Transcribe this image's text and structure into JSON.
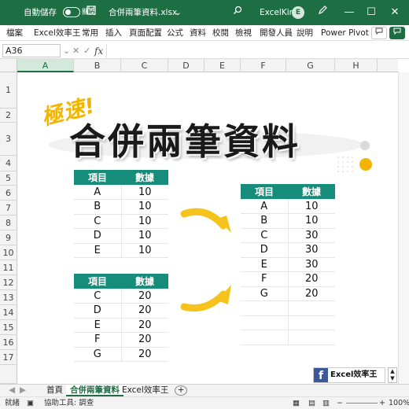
{
  "titlebar": {
    "autosave_label": "自動儲存",
    "autosave_state": "關閉",
    "filename": "合併兩筆資料.xlsx",
    "filename_chevron": "⌄",
    "search_icon": "search-icon",
    "user_name": "ExcelKing",
    "user_initial": "E",
    "pen_icon": "pen-icon",
    "minimize": "—",
    "maximize": "☐",
    "close": "✕",
    "save_icon": "save-icon"
  },
  "ribbon": {
    "tabs": [
      "檔案",
      "Excel效率王",
      "常用",
      "插入",
      "頁面配置",
      "公式",
      "資料",
      "校閱",
      "檢視",
      "開發人員",
      "說明",
      "Power Pivot"
    ],
    "comment_icon": "comment-icon",
    "share_icon": "share-icon"
  },
  "formula_bar": {
    "name_box": "A36",
    "cancel": "✕",
    "enter": "✓",
    "fx": "fx",
    "value": ""
  },
  "grid": {
    "columns": [
      "A",
      "B",
      "C",
      "D",
      "E",
      "F",
      "G",
      "H"
    ],
    "selected_column": "A",
    "rows": [
      "1",
      "2",
      "3",
      "4",
      "5",
      "6",
      "7",
      "8",
      "9",
      "10",
      "11",
      "12",
      "13",
      "14",
      "15",
      "16",
      "17"
    ]
  },
  "infographic": {
    "subtitle": "極速!",
    "title": "合併兩筆資料",
    "table1": {
      "headers": [
        "項目",
        "數據"
      ],
      "rows": [
        [
          "A",
          "10"
        ],
        [
          "B",
          "10"
        ],
        [
          "C",
          "10"
        ],
        [
          "D",
          "10"
        ],
        [
          "E",
          "10"
        ]
      ]
    },
    "table2": {
      "headers": [
        "項目",
        "數據"
      ],
      "rows": [
        [
          "C",
          "20"
        ],
        [
          "D",
          "20"
        ],
        [
          "E",
          "20"
        ],
        [
          "F",
          "20"
        ],
        [
          "G",
          "20"
        ]
      ]
    },
    "result": {
      "headers": [
        "項目",
        "數據"
      ],
      "rows": [
        [
          "A",
          "10"
        ],
        [
          "B",
          "10"
        ],
        [
          "C",
          "30"
        ],
        [
          "D",
          "30"
        ],
        [
          "E",
          "30"
        ],
        [
          "F",
          "20"
        ],
        [
          "G",
          "20"
        ]
      ]
    },
    "badge": "Excel效率王",
    "colors": {
      "header_teal": "#168c7a",
      "accent_yellow": "#f2b400",
      "arrow_yellow": "#f6c21c"
    }
  },
  "sheets": {
    "tabs": [
      "首頁",
      "合併兩筆資料",
      "Excel效率王"
    ],
    "active": "合併兩筆資料",
    "add": "+"
  },
  "status": {
    "ready": "就緒",
    "accessibility": "協助工具: 調查",
    "zoom": "100%"
  }
}
